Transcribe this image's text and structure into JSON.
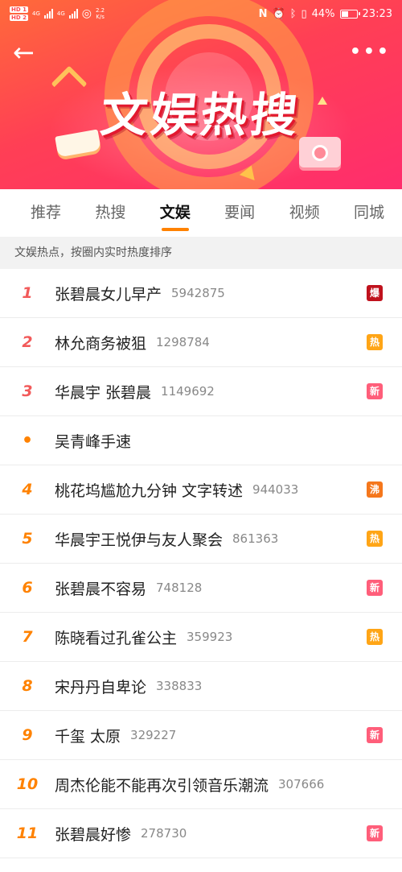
{
  "status_bar": {
    "hd1": "HD 1",
    "hd2": "HD 2",
    "net1": "4G",
    "net2": "4G",
    "speed_value": "2.2",
    "speed_unit": "K/s",
    "battery": "44%",
    "time": "23:23"
  },
  "header": {
    "title": "文娱热搜"
  },
  "tabs": [
    {
      "label": "推荐",
      "active": false
    },
    {
      "label": "热搜",
      "active": false
    },
    {
      "label": "文娱",
      "active": true
    },
    {
      "label": "要闻",
      "active": false
    },
    {
      "label": "视频",
      "active": false
    },
    {
      "label": "同城",
      "active": false
    }
  ],
  "subtitle": "文娱热点，按圈内实时热度排序",
  "badge_colors": {
    "爆": "#c0121d",
    "热": "#ffa516",
    "新": "#ff5e7a",
    "沸": "#f5771c"
  },
  "items": [
    {
      "rank": "1",
      "title": "张碧晨女儿早产",
      "count": "5942875",
      "badge": "爆"
    },
    {
      "rank": "2",
      "title": "林允商务被狙",
      "count": "1298784",
      "badge": "热"
    },
    {
      "rank": "3",
      "title": "华晨宇 张碧晨",
      "count": "1149692",
      "badge": "新"
    },
    {
      "rank": "•",
      "title": "吴青峰手速",
      "count": "",
      "badge": ""
    },
    {
      "rank": "4",
      "title": "桃花坞尴尬九分钟 文字转述",
      "count": "944033",
      "badge": "沸"
    },
    {
      "rank": "5",
      "title": "华晨宇王悦伊与友人聚会",
      "count": "861363",
      "badge": "热"
    },
    {
      "rank": "6",
      "title": "张碧晨不容易",
      "count": "748128",
      "badge": "新"
    },
    {
      "rank": "7",
      "title": "陈晓看过孔雀公主",
      "count": "359923",
      "badge": "热"
    },
    {
      "rank": "8",
      "title": "宋丹丹自卑论",
      "count": "338833",
      "badge": ""
    },
    {
      "rank": "9",
      "title": "千玺 太原",
      "count": "329227",
      "badge": "新"
    },
    {
      "rank": "10",
      "title": "周杰伦能不能再次引领音乐潮流",
      "count": "307666",
      "badge": ""
    },
    {
      "rank": "11",
      "title": "张碧晨好惨",
      "count": "278730",
      "badge": "新"
    }
  ]
}
